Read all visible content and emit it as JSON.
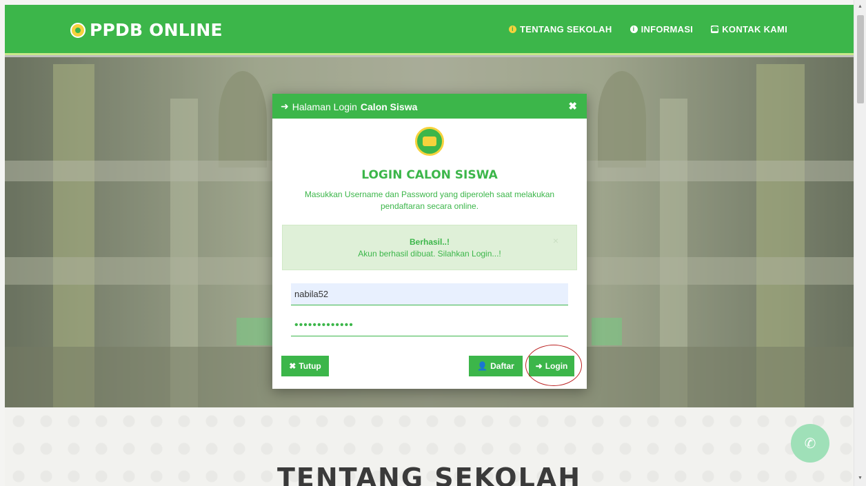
{
  "navbar": {
    "brand": "PPDB ONLINE",
    "items": [
      {
        "label": "TENTANG SEKOLAH",
        "icon": "info-circle-icon"
      },
      {
        "label": "INFORMASI",
        "icon": "info-icon"
      },
      {
        "label": "KONTAK KAMI",
        "icon": "phone-square-icon"
      }
    ]
  },
  "modal": {
    "header_prefix": "Halaman Login",
    "header_bold": "Calon Siswa",
    "title": "LOGIN CALON SISWA",
    "description": "Masukkan Username dan Password yang diperoleh saat melakukan pendaftaran secara online.",
    "alert": {
      "heading": "Berhasil..!",
      "message": "Akun berhasil dibuat. Silahkan Login...!",
      "close": "×"
    },
    "username_value": "nabila52",
    "password_value": "•••••••••••••",
    "buttons": {
      "tutup": "Tutup",
      "daftar": "Daftar",
      "login": "Login"
    }
  },
  "section_title": "TENTANG SEKOLAH",
  "colors": {
    "primary": "#3cb64a",
    "accent": "#f6d23c",
    "alert_bg": "#dff0d8"
  }
}
